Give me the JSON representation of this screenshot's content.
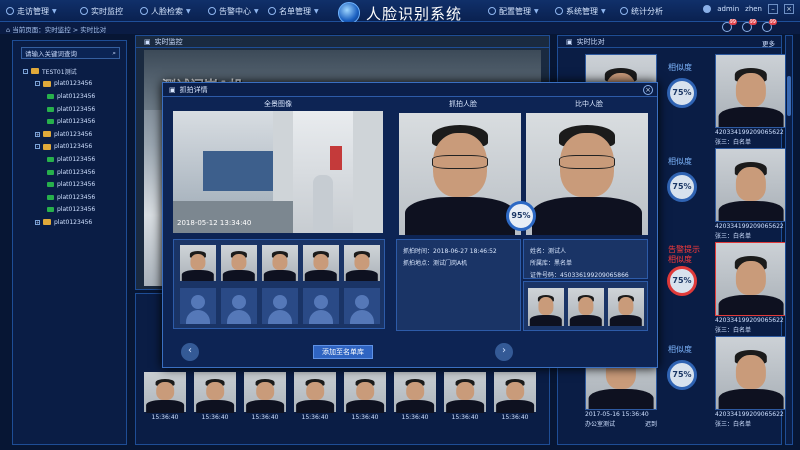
{
  "header": {
    "title": "人脸识别系统",
    "nav_left": [
      {
        "label": "走访管理",
        "icon": "visit-icon"
      },
      {
        "label": "实时监控",
        "icon": "monitor-icon"
      },
      {
        "label": "人脸检索",
        "icon": "face-search-icon"
      },
      {
        "label": "告警中心",
        "icon": "alarm-icon"
      },
      {
        "label": "名单管理",
        "icon": "list-icon"
      }
    ],
    "nav_right": [
      {
        "label": "配置管理",
        "icon": "config-icon"
      },
      {
        "label": "系统管理",
        "icon": "system-icon"
      },
      {
        "label": "统计分析",
        "icon": "stats-icon"
      }
    ],
    "user": "admin",
    "user_suffix": "zhen",
    "badges": [
      "99",
      "99",
      "99"
    ]
  },
  "breadcrumb": "当前页面：实时监控 > 实时比对",
  "sidebar": {
    "search_placeholder": "请输入关键词查询",
    "tree": [
      {
        "label": "TEST01测试",
        "level": 0,
        "type": "folder",
        "toggle": "-"
      },
      {
        "label": "plat0123456",
        "level": 1,
        "type": "folder",
        "toggle": "-"
      },
      {
        "label": "plat0123456",
        "level": 2,
        "type": "cam"
      },
      {
        "label": "plat0123456",
        "level": 2,
        "type": "cam"
      },
      {
        "label": "plat0123456",
        "level": 2,
        "type": "cam"
      },
      {
        "label": "plat0123456",
        "level": 1,
        "type": "folder",
        "toggle": "+"
      },
      {
        "label": "plat0123456",
        "level": 1,
        "type": "folder",
        "toggle": "-"
      },
      {
        "label": "plat0123456",
        "level": 2,
        "type": "cam"
      },
      {
        "label": "plat0123456",
        "level": 2,
        "type": "cam"
      },
      {
        "label": "plat0123456",
        "level": 2,
        "type": "cam"
      },
      {
        "label": "plat0123456",
        "level": 2,
        "type": "cam"
      },
      {
        "label": "plat0123456",
        "level": 2,
        "type": "cam"
      },
      {
        "label": "plat0123456",
        "level": 1,
        "type": "folder",
        "toggle": "+"
      }
    ]
  },
  "live": {
    "title": "实时监控",
    "watermark": "测试门岗A机",
    "captures": [
      "15:36:40",
      "15:36:40",
      "15:36:40",
      "15:36:40",
      "15:36:40",
      "15:36:40",
      "15:36:40",
      "15:36:40"
    ]
  },
  "right": {
    "title": "实时比对",
    "more": "更多",
    "cards": [
      {
        "label": "相似度",
        "pct": "75%",
        "alarm": false,
        "id": "420334199209065622",
        "name": "张三：白名单",
        "date": "",
        "location": "",
        "tag": ""
      },
      {
        "label": "相似度",
        "pct": "75%",
        "alarm": false,
        "id": "420334199209065622",
        "name": "张三：白名单",
        "date": "",
        "location": "",
        "tag": ""
      },
      {
        "label": "告警提示",
        "label2": "相似度",
        "pct": "75%",
        "alarm": true,
        "id": "420334199209065622",
        "name": "张三：白名单",
        "date": "",
        "location": "",
        "tag": ""
      },
      {
        "label": "相似度",
        "pct": "75%",
        "alarm": false,
        "id": "420334199209065622",
        "name": "张三：白名单",
        "date": "2017-05-16 15:36:40",
        "location": "办公室测试",
        "tag": "迟到"
      }
    ]
  },
  "modal": {
    "title": "抓拍详情",
    "col_scene": "全景图像",
    "col_capture": "抓拍人脸",
    "col_match": "比中人脸",
    "scene_time": "2018-05-12 13:34:40",
    "similarity": "95%",
    "capture_time_label": "抓拍时间：",
    "capture_time": "2018-06-27     18:46:52",
    "capture_place_label": "抓拍地点：",
    "capture_place": "测试门岗A机",
    "name_label": "姓名：",
    "name": "测试人",
    "lib_label": "所属库：",
    "lib": "黑名单",
    "cert_label": "证件号码：",
    "cert": "450336199209065866",
    "add_button": "添加至名单库",
    "prev": "‹",
    "next": "›",
    "close": "×"
  }
}
